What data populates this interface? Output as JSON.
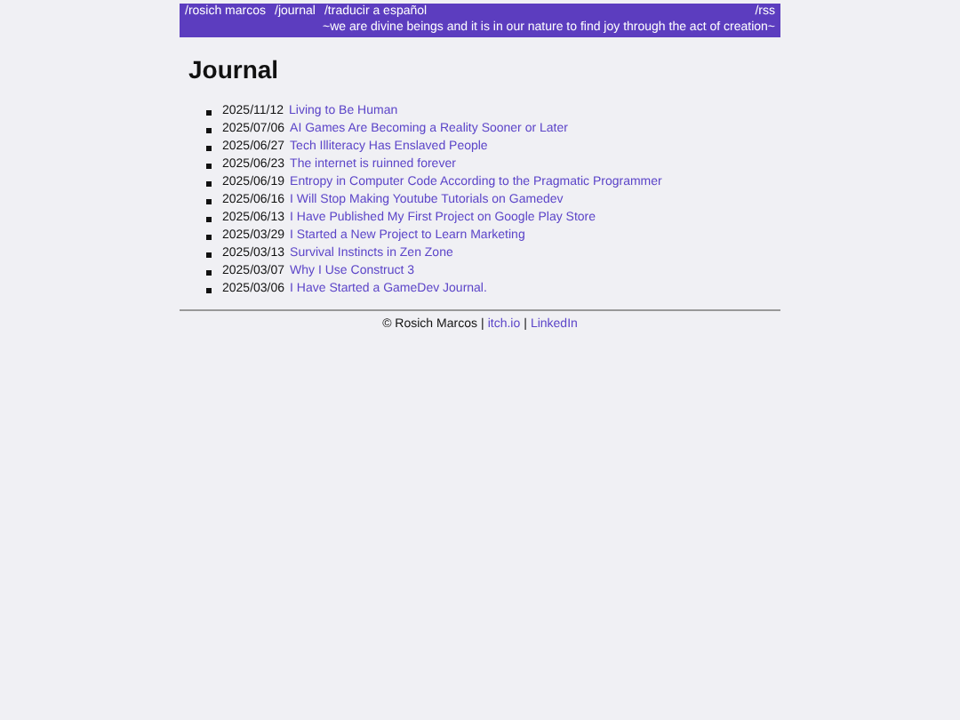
{
  "header": {
    "nav": [
      "/rosich marcos",
      "/journal",
      "/traducir a español"
    ],
    "rss": "/rss",
    "tagline": "~we are divine beings and it is in our nature to find joy through the act of creation~"
  },
  "title": "Journal",
  "entries": [
    {
      "date": "2025/11/12",
      "title": "Living to Be Human"
    },
    {
      "date": "2025/07/06",
      "title": "AI Games Are Becoming a Reality Sooner or Later"
    },
    {
      "date": "2025/06/27",
      "title": "Tech Illiteracy Has Enslaved People"
    },
    {
      "date": "2025/06/23",
      "title": "The internet is ruinned forever"
    },
    {
      "date": "2025/06/19",
      "title": "Entropy in Computer Code According to the Pragmatic Programmer"
    },
    {
      "date": "2025/06/16",
      "title": "I Will Stop Making Youtube Tutorials on Gamedev"
    },
    {
      "date": "2025/06/13",
      "title": "I Have Published My First Project on Google Play Store"
    },
    {
      "date": "2025/03/29",
      "title": "I Started a New Project to Learn Marketing"
    },
    {
      "date": "2025/03/13",
      "title": "Survival Instincts in Zen Zone"
    },
    {
      "date": "2025/03/07",
      "title": "Why I Use Construct 3"
    },
    {
      "date": "2025/03/06",
      "title": "I Have Started a GameDev Journal."
    }
  ],
  "footer": {
    "copyright": "© Rosich Marcos",
    "links": [
      "itch.io",
      "LinkedIn"
    ],
    "separator": "|"
  }
}
